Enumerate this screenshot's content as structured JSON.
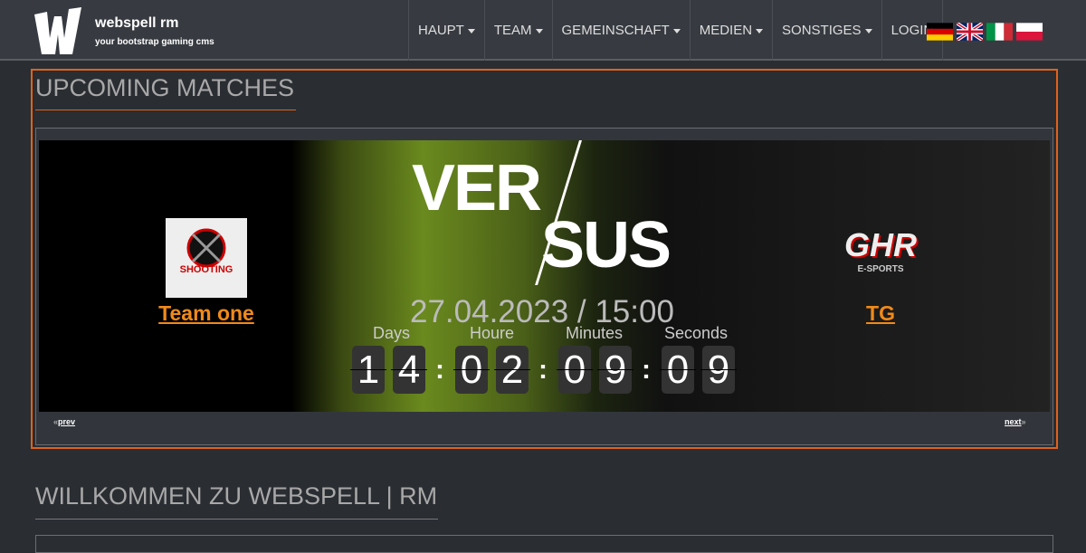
{
  "header": {
    "brand": "webspell rm",
    "tagline": "your bootstrap gaming cms",
    "logo_letter": "W"
  },
  "nav": [
    {
      "label": "HAUPT",
      "dropdown": true
    },
    {
      "label": "TEAM",
      "dropdown": true
    },
    {
      "label": "GEMEINSCHAFT",
      "dropdown": true
    },
    {
      "label": "MEDIEN",
      "dropdown": true
    },
    {
      "label": "SONSTIGES",
      "dropdown": true
    },
    {
      "label": "LOGIN",
      "dropdown": false
    }
  ],
  "languages": [
    "de",
    "en",
    "it",
    "pl"
  ],
  "upcoming": {
    "title": "UPCOMING MATCHES",
    "versus_top": "VER",
    "versus_bottom": "SUS",
    "team1": {
      "name": "Team one",
      "logo_text": "SHOOTING"
    },
    "team2": {
      "name": "TG",
      "logo_text": "GHR",
      "logo_sub": "E-SPORTS"
    },
    "datetime": "27.04.2023 / 15:00",
    "countdown": {
      "labels": [
        "Days",
        "Houre",
        "Minutes",
        "Seconds"
      ],
      "digits": [
        "1",
        "4",
        "0",
        "2",
        "0",
        "9",
        "0",
        "9"
      ]
    },
    "prev": "prev",
    "next": "next"
  },
  "welcome": {
    "title": "WILLKOMMEN ZU WEBSPELL | RM"
  },
  "colors": {
    "accent": "#e0621a",
    "link": "#f08a1a"
  }
}
